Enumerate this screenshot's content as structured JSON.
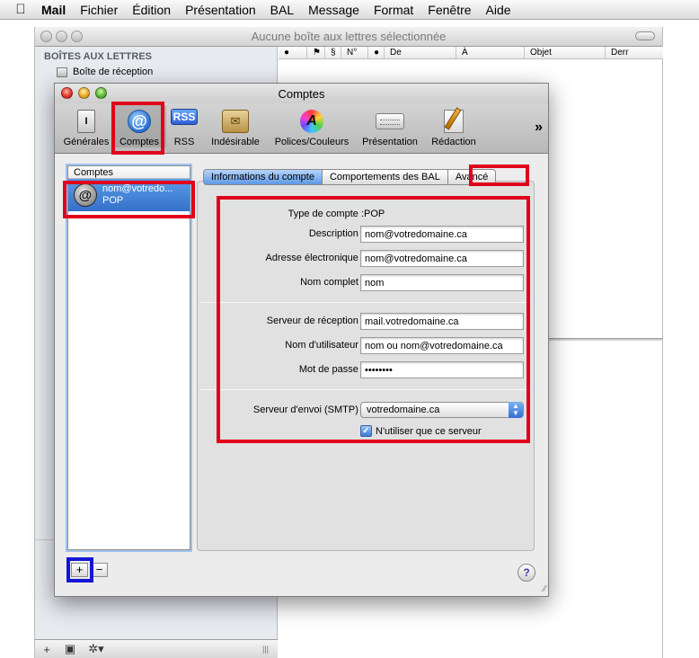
{
  "menubar": {
    "apple_icon": "apple-logo-icon",
    "app": "Mail",
    "items": [
      "Fichier",
      "Édition",
      "Présentation",
      "BAL",
      "Message",
      "Format",
      "Fenêtre",
      "Aide"
    ]
  },
  "main_window": {
    "title": "Aucune boîte aux lettres sélectionnée",
    "sidebar_header": "BOÎTES AUX LETTRES",
    "inbox_label": "Boîte de réception",
    "columns": [
      "●",
      "⚑",
      "§",
      "N°",
      "●",
      "De",
      "À",
      "Objet",
      "Derr"
    ],
    "bottom_buttons": [
      "+",
      "▣",
      "✲▾"
    ]
  },
  "prefs": {
    "title": "Comptes",
    "toolbar": [
      {
        "label": "Générales",
        "icon": "switch-icon"
      },
      {
        "label": "Comptes",
        "icon": "at-sign-icon"
      },
      {
        "label": "RSS",
        "icon": "rss-icon"
      },
      {
        "label": "Indésirable",
        "icon": "junk-mail-icon"
      },
      {
        "label": "Polices/Couleurs",
        "icon": "color-wheel-icon"
      },
      {
        "label": "Présentation",
        "icon": "viewing-icon"
      },
      {
        "label": "Rédaction",
        "icon": "composing-icon"
      }
    ],
    "toolbar_overflow": "»",
    "account_list": {
      "header": "Comptes",
      "items": [
        {
          "name": "nom@votredo...",
          "type": "POP"
        }
      ]
    },
    "add_button": "+",
    "remove_button": "−",
    "tabs": [
      "Informations du compte",
      "Comportements des BAL",
      "Avancé"
    ],
    "active_tab": "Informations du compte",
    "fields": {
      "account_type_label": "Type de compte :",
      "account_type_value": "POP",
      "description_label": "Description :",
      "description_value": "nom@votredomaine.ca",
      "email_label": "Adresse électronique :",
      "email_value": "nom@votredomaine.ca",
      "fullname_label": "Nom complet :",
      "fullname_value": "nom",
      "incoming_label": "Serveur de réception :",
      "incoming_value": "mail.votredomaine.ca",
      "username_label": "Nom d'utilisateur :",
      "username_value": "nom ou nom@votredomaine.ca",
      "password_label": "Mot de passe :",
      "password_value": "••••••••",
      "smtp_label": "Serveur d'envoi (SMTP) :",
      "smtp_value": "votredomaine.ca",
      "only_server_label": "N'utiliser que ce serveur",
      "only_server_checked": true
    },
    "help": "?"
  },
  "colors": {
    "highlight_red": "#e0001b",
    "highlight_blue": "#1515d6",
    "selection_blue": "#3470c9"
  }
}
